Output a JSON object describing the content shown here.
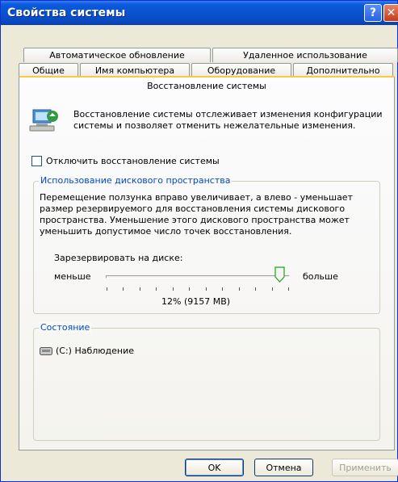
{
  "window": {
    "title": "Свойства системы"
  },
  "tabs": {
    "back_row": [
      "Автоматическое обновление",
      "Удаленное использование"
    ],
    "front_row": [
      "Общие",
      "Имя компьютера",
      "Оборудование",
      "Дополнительно"
    ],
    "active": "Восстановление системы"
  },
  "intro": {
    "text": "Восстановление системы отслеживает изменения конфигурации системы и позволяет отменить нежелательные изменения."
  },
  "disable_checkbox": {
    "label": "Отключить восстановление системы",
    "checked": false
  },
  "disk_usage": {
    "title": "Использование дискового пространства",
    "description": "Перемещение ползунка вправо увеличивает, а влево - уменьшает размер резервируемого для восстановления системы дискового пространства. Уменьшение этого дискового пространства может уменьшить допустимое число точек восстановления.",
    "reserve_label": "Зарезервировать на диске:",
    "less": "меньше",
    "more": "больше",
    "value_text": "12% (9157 MB)",
    "slider_level": 0.95
  },
  "status": {
    "title": "Состояние",
    "drive": "(C:) Наблюдение"
  },
  "buttons": {
    "ok": "OK",
    "cancel": "Отмена",
    "apply": "Применить"
  },
  "colors": {
    "title_bar": "#0a52cf",
    "group_title": "#0046d5",
    "active_tab_highlight": "#ffc73c"
  }
}
